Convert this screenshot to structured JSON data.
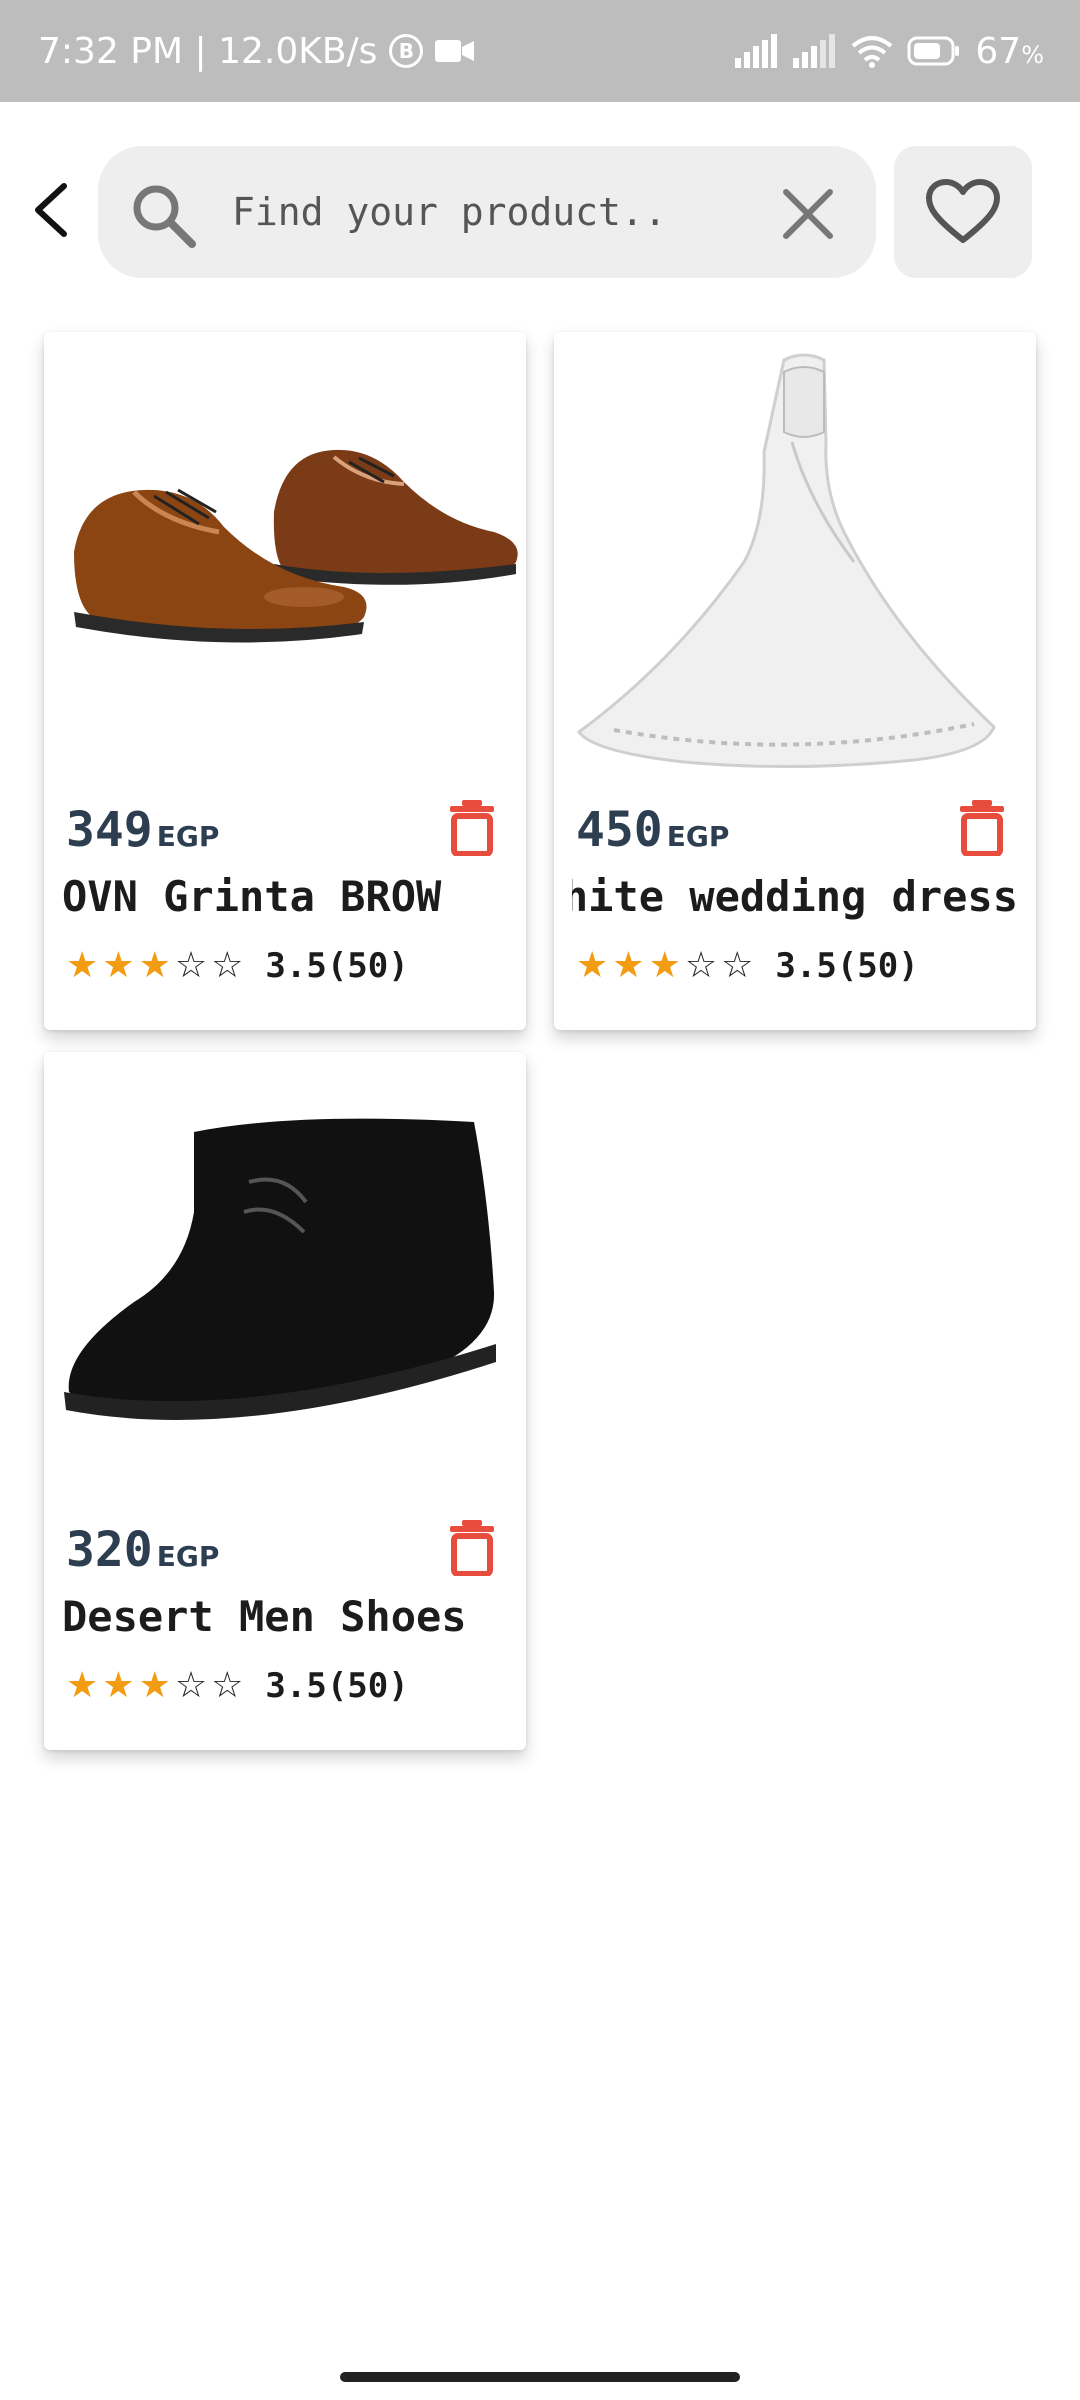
{
  "status_bar": {
    "time_speed": "7:32 PM | 12.0KB/s",
    "badge_letter": "B",
    "battery": "67",
    "battery_unit": "%"
  },
  "search": {
    "placeholder": "Find your product..",
    "value": ""
  },
  "icons": {
    "back": "chevron-left-icon",
    "search": "search-icon",
    "clear": "close-icon",
    "favorite": "heart-outline-icon",
    "delete": "trash-icon"
  },
  "colors": {
    "accent_star": "#f39c12",
    "delete_red": "#e74c3c",
    "price_text": "#2c3e50",
    "search_bg": "#eeeeee",
    "status_bar_bg": "#bdbdbd"
  },
  "products": [
    {
      "price": "349",
      "currency": "EGP",
      "name": "OVN Grinta    BROW",
      "rating_stars": 3,
      "rating_text": "3.5(50)",
      "image": "brown-leather-shoes"
    },
    {
      "price": "450",
      "currency": "EGP",
      "name": "White wedding dress",
      "rating_stars": 3,
      "rating_text": "3.5(50)",
      "image": "white-wedding-dress"
    },
    {
      "price": "320",
      "currency": "EGP",
      "name": "Desert Men Shoes",
      "rating_stars": 3,
      "rating_text": "3.5(50)",
      "image": "black-suede-boot"
    }
  ]
}
